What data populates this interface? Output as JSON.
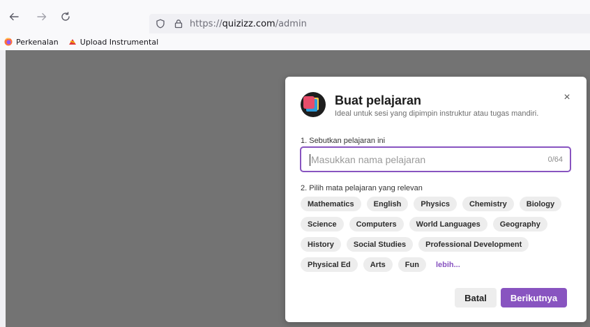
{
  "browser": {
    "url_prefix": "https://",
    "url_domain": "quizizz.com",
    "url_path": "/admin",
    "bookmarks": [
      {
        "label": "Perkenalan",
        "icon": "firefox-icon"
      },
      {
        "label": "Upload Instrumental",
        "icon": "bookmark-favicon"
      }
    ]
  },
  "modal": {
    "title": "Buat pelajaran",
    "subtitle": "Ideal untuk sesi yang dipimpin instruktur atau tugas mandiri.",
    "close_label": "×",
    "step1_label": "1. Sebutkan pelajaran ini",
    "name_input": {
      "value": "",
      "placeholder": "Masukkan nama pelajaran"
    },
    "counter": "0/64",
    "step2_label": "2. Pilih mata pelajaran yang relevan",
    "subjects": [
      "Mathematics",
      "English",
      "Physics",
      "Chemistry",
      "Biology",
      "Science",
      "Computers",
      "World Languages",
      "Geography",
      "History",
      "Social Studies",
      "Professional Development",
      "Physical Ed",
      "Arts",
      "Fun"
    ],
    "more_label": "lebih...",
    "cancel_label": "Batal",
    "next_label": "Berikutnya"
  },
  "colors": {
    "accent": "#8854c0",
    "overlay": "#737373",
    "chip_bg": "#ededed"
  }
}
